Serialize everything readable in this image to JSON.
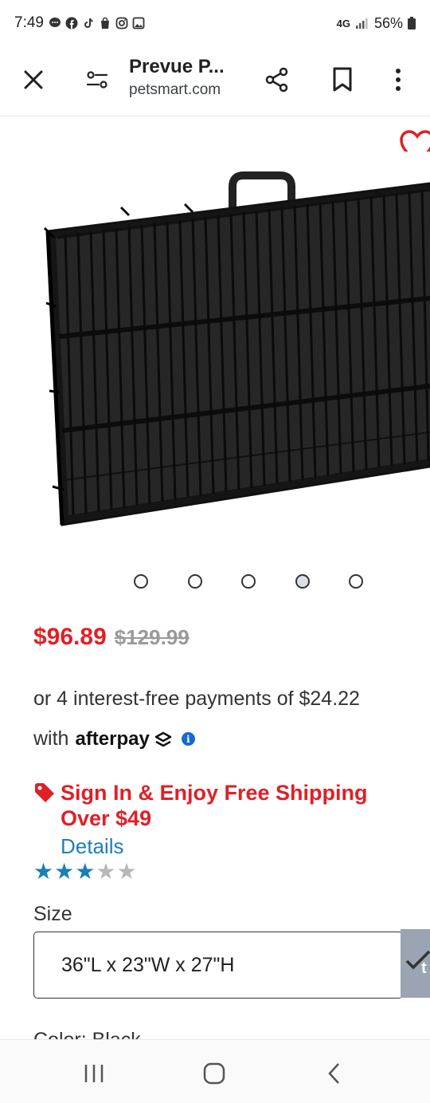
{
  "status_bar": {
    "time": "7:49",
    "network": "4G",
    "battery": "56%"
  },
  "toolbar": {
    "title": "Prevue P...",
    "domain": "petsmart.com"
  },
  "carousel": {
    "dot_count": 5,
    "active_index": 3
  },
  "price": {
    "sale": "$96.89",
    "original": "$129.99"
  },
  "afterpay": {
    "line1": "or 4 interest-free payments of $24.22",
    "with": "with",
    "logo": "afterpay"
  },
  "promo": {
    "text": "Sign In & Enjoy Free Shipping Over $49",
    "details": "Details"
  },
  "rating": {
    "stars_filled": 3,
    "stars_total": 5
  },
  "size": {
    "label": "Size",
    "selected": "36\"L x 23\"W x 27\"H",
    "badge": "t"
  },
  "color": {
    "label": "Color: Black"
  },
  "colors": {
    "accent_red": "#e11f26",
    "link_blue": "#1e7fb8",
    "star_blue": "#1a7fb5",
    "star_gray": "#b8b8b8"
  }
}
